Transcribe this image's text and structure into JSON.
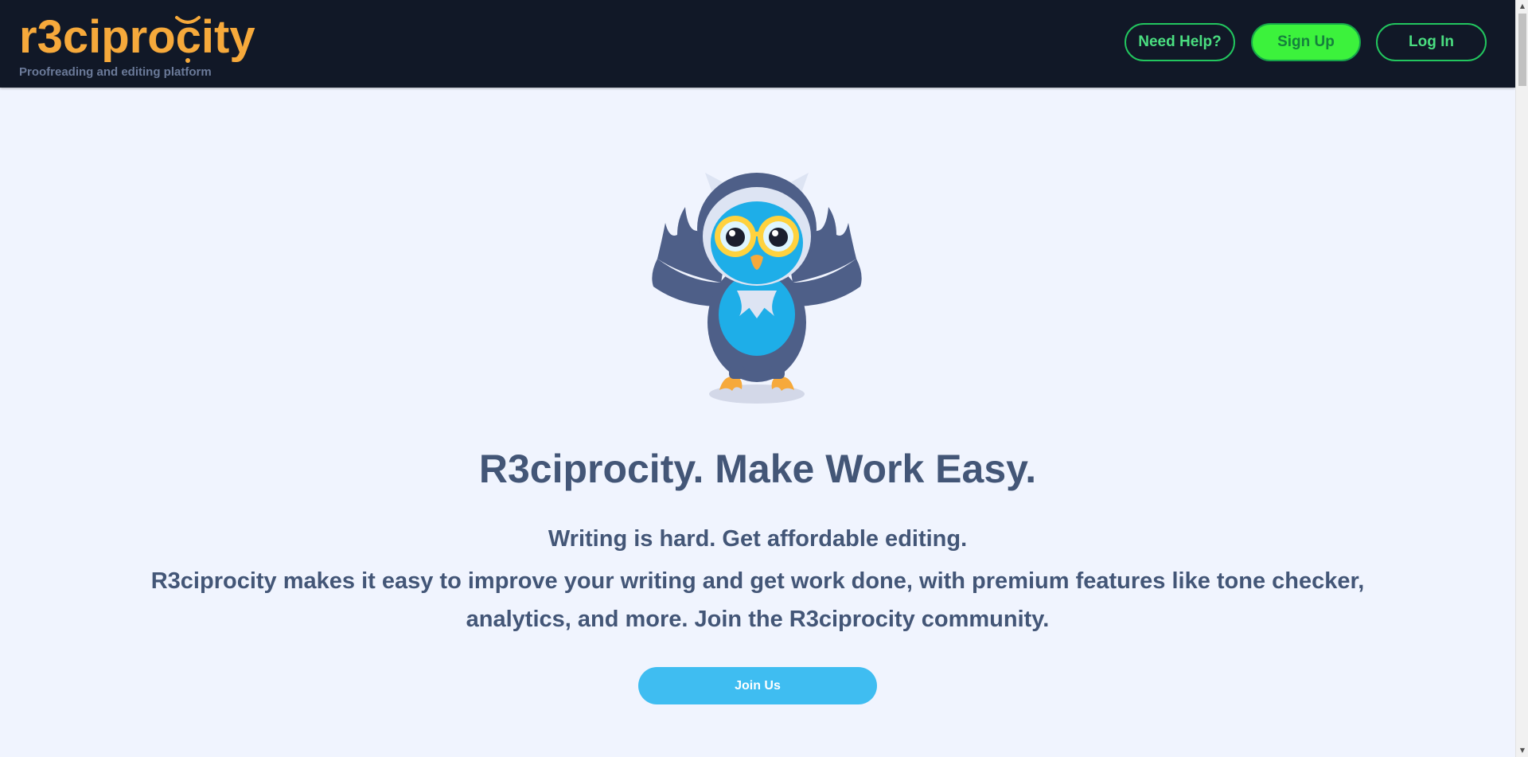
{
  "brand": {
    "logo_text": "r3ciprocity",
    "tagline": "Proofreading and editing platform",
    "logo_color": "#f6a93b"
  },
  "nav": {
    "help_label": "Need Help?",
    "signup_label": "Sign Up",
    "login_label": "Log In"
  },
  "hero": {
    "mascot_icon": "owl-mascot",
    "title": "R3ciprocity. Make Work Easy.",
    "subtitle": "Writing is hard. Get affordable editing.",
    "description": "R3ciprocity makes it easy to improve your writing and get work done, with premium features like tone checker, analytics, and more. Join the R3ciprocity community.",
    "cta_label": "Join Us"
  },
  "colors": {
    "navbar_bg": "#111827",
    "page_bg": "#f0f4fe",
    "accent_green": "#22c55e",
    "cta_blue": "#3fbdf1",
    "text": "#435677"
  }
}
